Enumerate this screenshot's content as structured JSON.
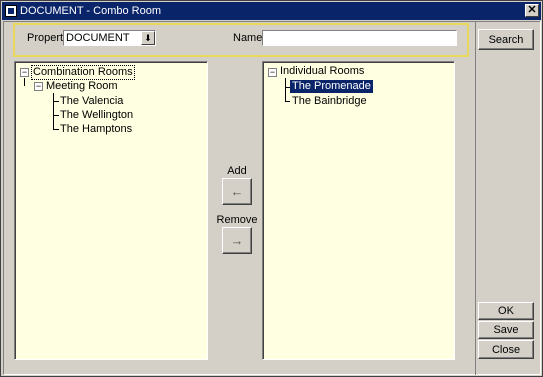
{
  "window": {
    "title": "DOCUMENT - Combo Room",
    "close_glyph": "✕"
  },
  "search": {
    "property_label": "Property",
    "property_value": "DOCUMENT",
    "name_label": "Name",
    "name_value": "",
    "dropdown_glyph": "⬇"
  },
  "buttons": {
    "search": "Search",
    "add_label": "Add",
    "add_glyph": "←",
    "remove_label": "Remove",
    "remove_glyph": "→",
    "ok": "OK",
    "save": "Save",
    "close": "Close"
  },
  "left_tree": {
    "root": "Combination Rooms",
    "group": "Meeting Room",
    "items": [
      "The Valencia",
      "The Wellington",
      "The Hamptons"
    ]
  },
  "right_tree": {
    "root": "Individual Rooms",
    "items": [
      "The Promenade",
      "The Bainbridge"
    ],
    "selected": "The Promenade"
  },
  "colors": {
    "titlebar": "#0a246a",
    "tree_background": "#ffffe1",
    "search_border": "#e8d85a",
    "selection": "#0a246a"
  },
  "icons": {
    "expander": "minus"
  }
}
